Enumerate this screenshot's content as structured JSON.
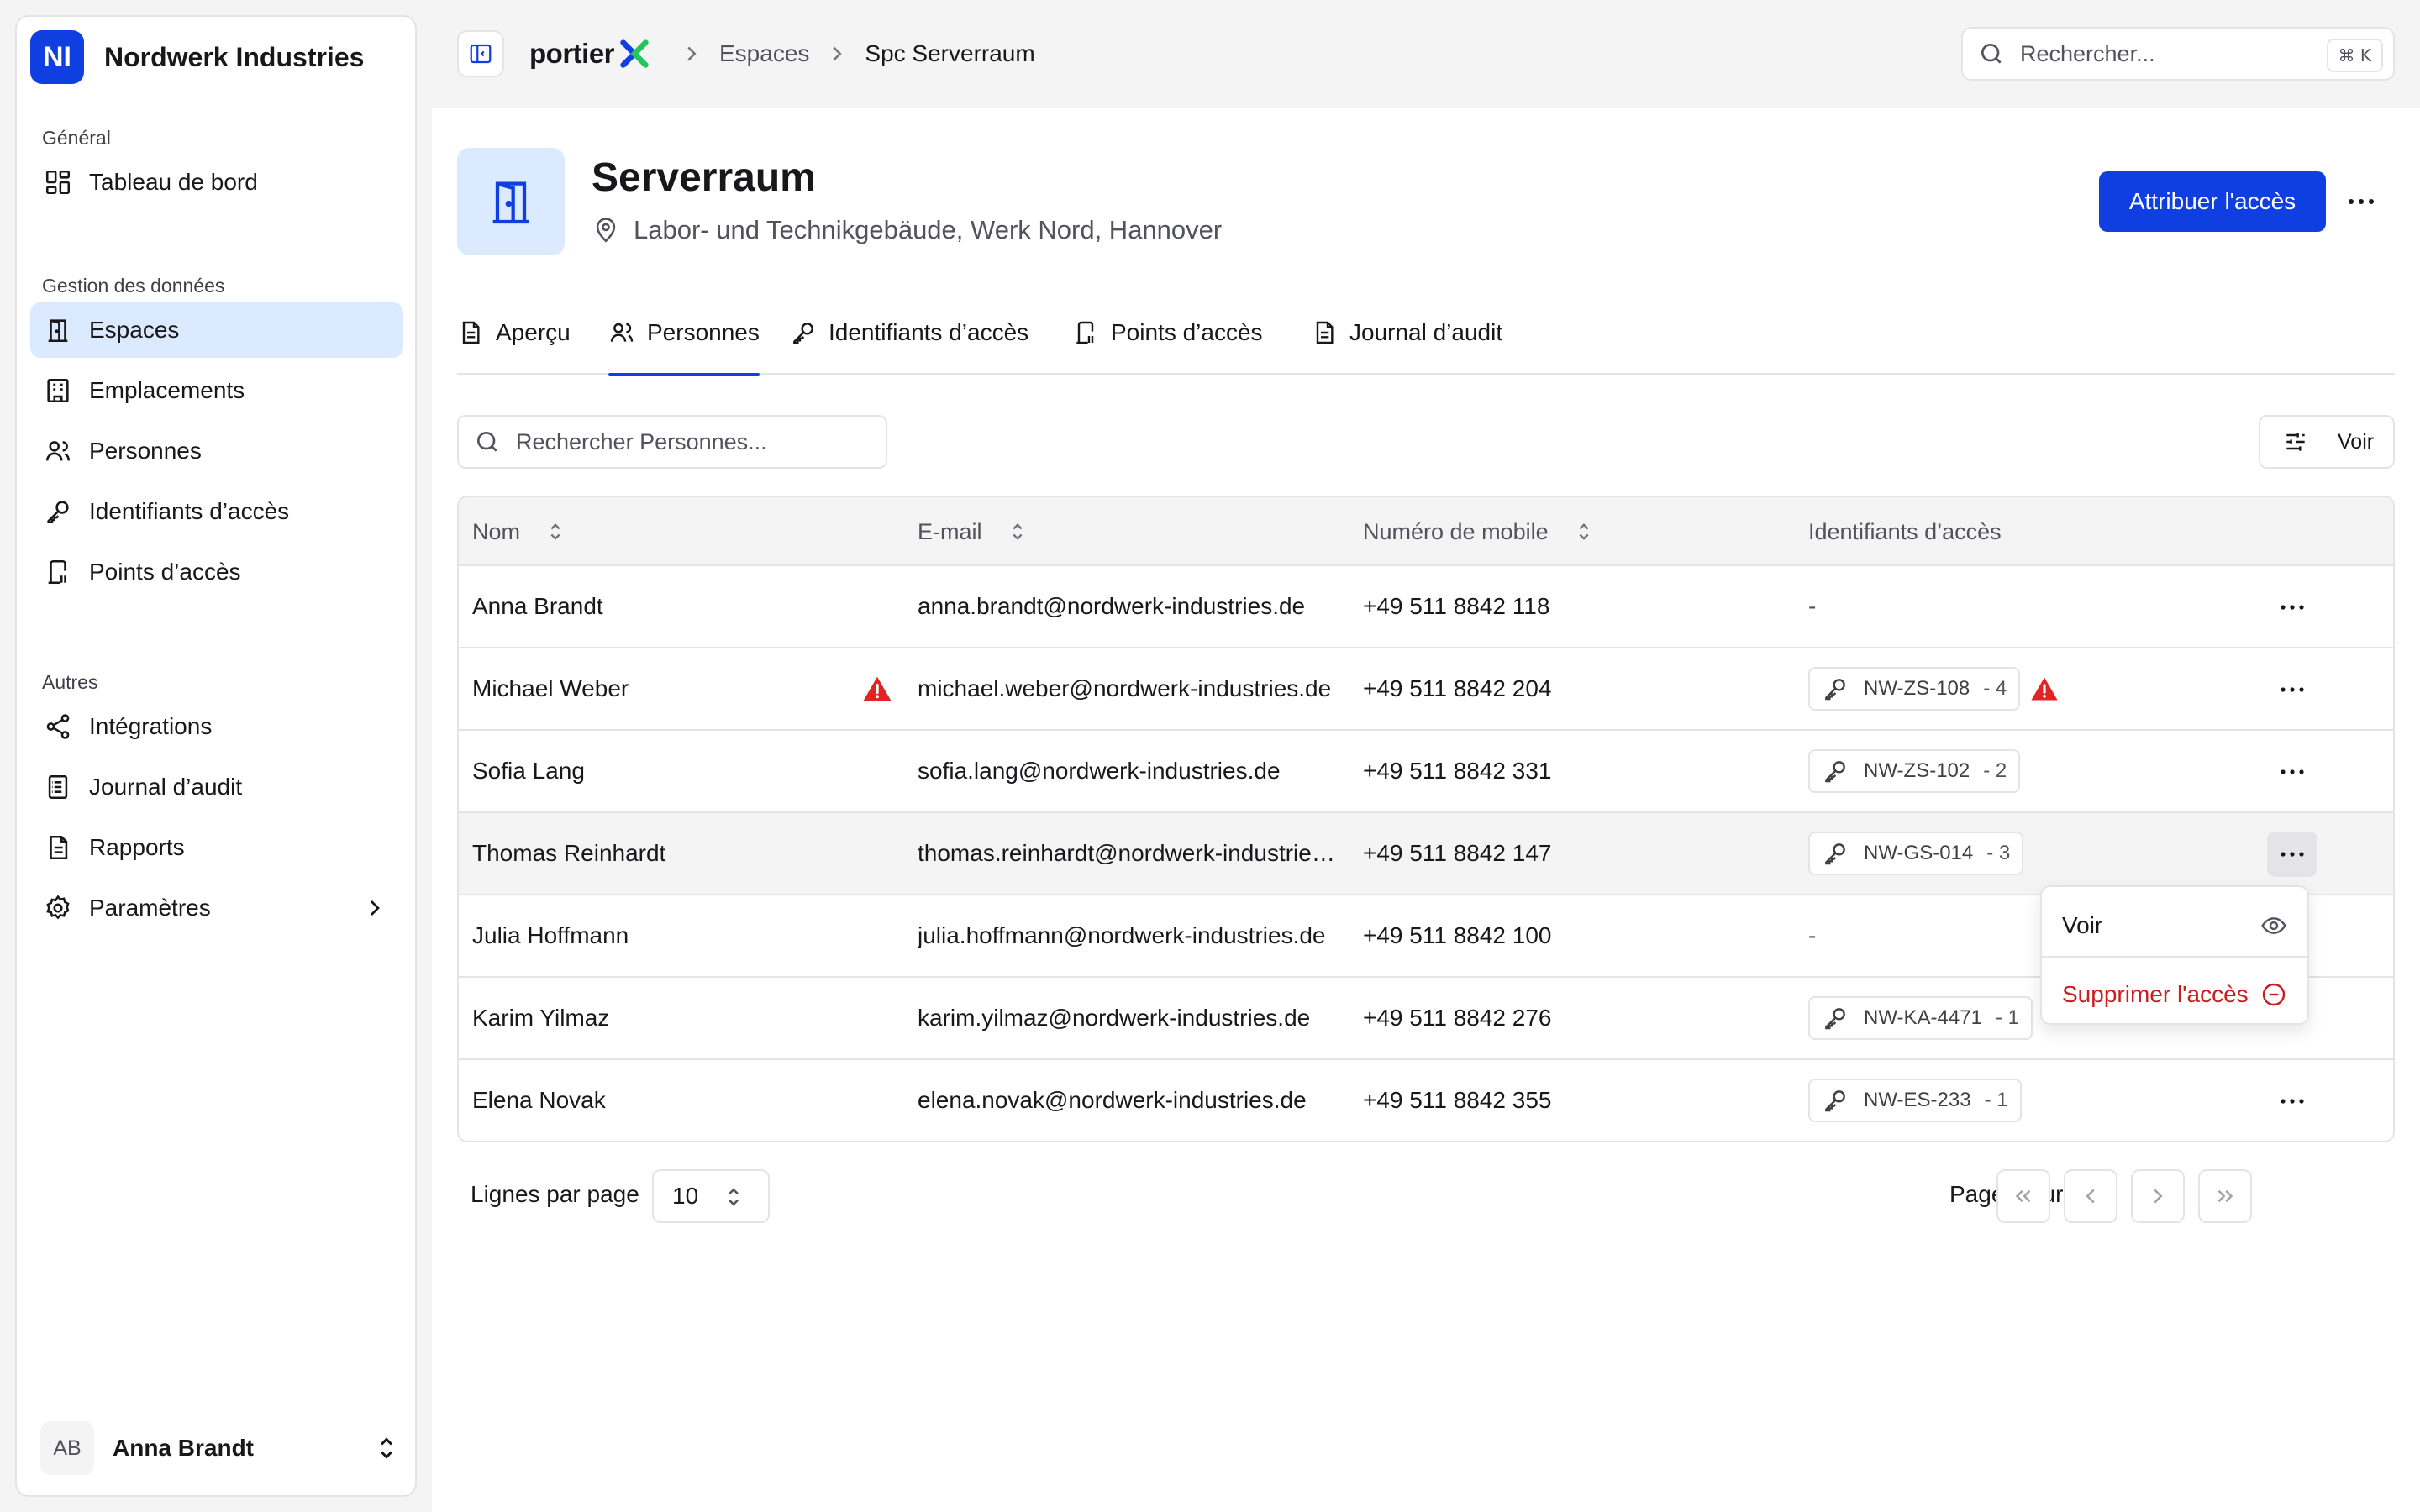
{
  "org": {
    "initials": "NI",
    "name": "Nordwerk Industries"
  },
  "sidebar": {
    "sections": [
      {
        "label": "Général",
        "items": [
          {
            "label": "Tableau de bord",
            "icon": "dashboard-icon"
          }
        ]
      },
      {
        "label": "Gestion des données",
        "items": [
          {
            "label": "Espaces",
            "icon": "door-icon",
            "active": true
          },
          {
            "label": "Emplacements",
            "icon": "building-icon"
          },
          {
            "label": "Personnes",
            "icon": "users-icon"
          },
          {
            "label": "Identifiants d’accès",
            "icon": "key-icon"
          },
          {
            "label": "Points d’accès",
            "icon": "access-point-icon"
          }
        ]
      },
      {
        "label": "Autres",
        "items": [
          {
            "label": "Intégrations",
            "icon": "share-icon"
          },
          {
            "label": "Journal d’audit",
            "icon": "log-icon"
          },
          {
            "label": "Rapports",
            "icon": "report-icon"
          },
          {
            "label": "Paramètres",
            "icon": "gear-icon"
          }
        ]
      }
    ],
    "user": {
      "initials": "AB",
      "name": "Anna Brandt"
    }
  },
  "topbar": {
    "brand": "portier",
    "breadcrumb": {
      "parent": "Espaces",
      "current": "Spc Serverraum"
    },
    "search_placeholder": "Rechercher...",
    "shortcut": "⌘ K"
  },
  "space": {
    "title": "Serverraum",
    "location": "Labor- und Technikgebäude, Werk Nord, Hannover",
    "primary_action": "Attribuer l'accès"
  },
  "tabs": [
    {
      "label": "Aperçu",
      "icon": "document-icon"
    },
    {
      "label": "Personnes",
      "icon": "users-icon",
      "active": true
    },
    {
      "label": "Identifiants d’accès",
      "icon": "key-icon"
    },
    {
      "label": "Points d’accès",
      "icon": "access-point-icon"
    },
    {
      "label": "Journal d’audit",
      "icon": "document-icon"
    }
  ],
  "table": {
    "search_placeholder": "Rechercher Personnes...",
    "view_label": "Voir",
    "columns": {
      "name": "Nom",
      "email": "E-mail",
      "mobile": "Numéro de mobile",
      "credentials": "Identifiants d’accès"
    },
    "rows": [
      {
        "name": "Anna Brandt",
        "email": "anna.brandt@nordwerk-industries.de",
        "mobile": "+49 511 8842 118",
        "credential": "-",
        "count": ""
      },
      {
        "name": "Michael Weber",
        "email": "michael.weber@nordwerk-industries.de",
        "mobile": "+49 511 8842 204",
        "credential": "NW-ZS-108",
        "count": "- 4",
        "warning": true
      },
      {
        "name": "Sofia Lang",
        "email": "sofia.lang@nordwerk-industries.de",
        "mobile": "+49 511 8842 331",
        "credential": "NW-ZS-102",
        "count": "- 2"
      },
      {
        "name": "Thomas Reinhardt",
        "email": "thomas.reinhardt@nordwerk-industries.de",
        "mobile": "+49 511 8842 147",
        "credential": "NW-GS-014",
        "count": "- 3"
      },
      {
        "name": "Julia Hoffmann",
        "email": "julia.hoffmann@nordwerk-industries.de",
        "mobile": "+49 511 8842 100",
        "credential": "-",
        "count": ""
      },
      {
        "name": "Karim Yilmaz",
        "email": "karim.yilmaz@nordwerk-industries.de",
        "mobile": "+49 511 8842 276",
        "credential": "NW-KA-4471",
        "count": "- 1"
      },
      {
        "name": "Elena Novak",
        "email": "elena.novak@nordwerk-industries.de",
        "mobile": "+49 511 8842 355",
        "credential": "NW-ES-233",
        "count": "- 1"
      }
    ]
  },
  "row_menu": {
    "view": "Voir",
    "remove": "Supprimer l'accès"
  },
  "pagination": {
    "rows_label": "Lignes par page",
    "rows_value": "10",
    "page_info": "Page 1 sur 1"
  },
  "colors": {
    "accent": "#0f3fe0",
    "active_bg": "#dbeafe",
    "danger": "#c81e1e",
    "warning": "#e02424"
  }
}
